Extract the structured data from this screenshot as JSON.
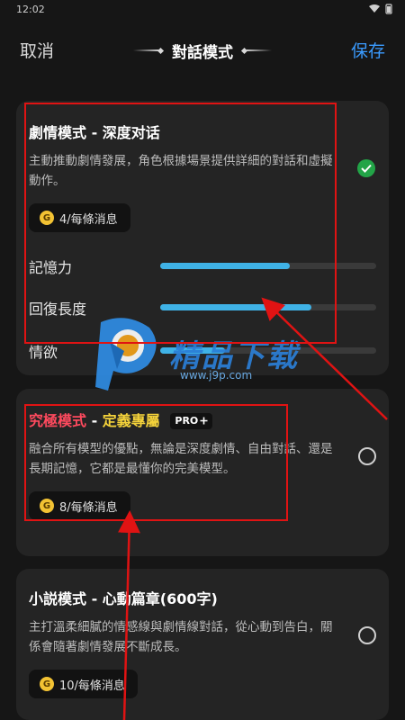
{
  "status_bar": {
    "time": "12:02"
  },
  "header": {
    "cancel_label": "取消",
    "title": "對話模式",
    "save_label": "保存"
  },
  "cards": [
    {
      "title": "劇情模式 - 深度对话",
      "description": "主動推動劇情發展，角色根據場景提供詳細的對話和虛擬動作。",
      "price": "4/每條消息",
      "selected": true,
      "sliders": [
        {
          "label": "記憶力",
          "level_percent": 60
        },
        {
          "label": "回復長度",
          "level_percent": 70
        },
        {
          "label": "情欲",
          "level_percent": 30
        }
      ]
    },
    {
      "title_part1": "究極模式",
      "title_sep": " - ",
      "title_part2": "定義專屬",
      "badge": "PRO",
      "description": "融合所有模型的優點，無論是深度劇情、自由對話、還是長期記憶，它都是最懂你的完美模型。",
      "price": "8/每條消息",
      "selected": false
    },
    {
      "title": "小説模式 - 心動篇章(600字)",
      "description": "主打溫柔細膩的情感線與劇情線對話，從心動到告白，關係會隨著劇情發展不斷成長。",
      "price": "10/每條消息",
      "selected": false
    }
  ],
  "coin_symbol": "G",
  "watermark": {
    "brand": "精品下载",
    "url": "www.j9p.com"
  },
  "colors": {
    "accent": "#3a9bff",
    "check": "#22a447",
    "slider_fill": "#3fb2e6",
    "annotation_red": "#e01313",
    "coin": "#f2c233"
  }
}
